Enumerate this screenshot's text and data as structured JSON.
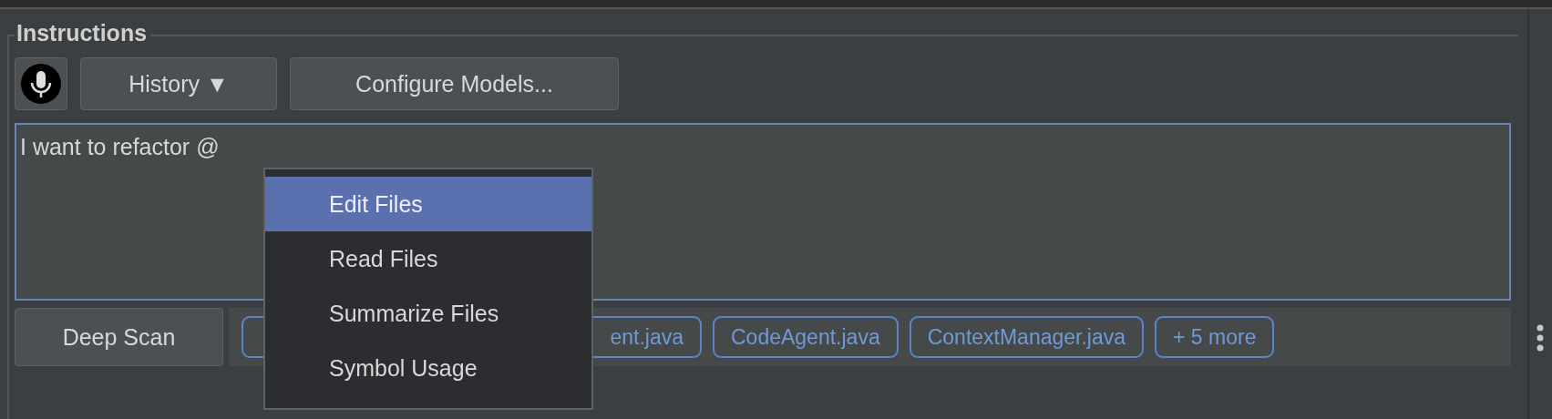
{
  "panel": {
    "title": "Instructions"
  },
  "toolbar": {
    "mic": {
      "kind": "mic"
    },
    "buttons": [
      {
        "label": "History ▼"
      },
      {
        "label": "Configure Models..."
      }
    ]
  },
  "instructions_field": {
    "value": "I want to refactor @"
  },
  "menu": {
    "items": [
      {
        "label": "Edit Files",
        "selected": true
      },
      {
        "label": "Read Files",
        "selected": false
      },
      {
        "label": "Summarize Files",
        "selected": false
      },
      {
        "label": "Symbol Usage",
        "selected": false
      }
    ]
  },
  "deep_scan_button": {
    "label": "Deep Scan"
  },
  "chips": [
    {
      "kind": "covered"
    },
    {
      "label": "ent.java",
      "kind": "cut"
    },
    {
      "label": "CodeAgent.java",
      "kind": "file"
    },
    {
      "label": "ContextManager.java",
      "kind": "file"
    },
    {
      "label": "+ 5 more",
      "kind": "file"
    }
  ]
}
